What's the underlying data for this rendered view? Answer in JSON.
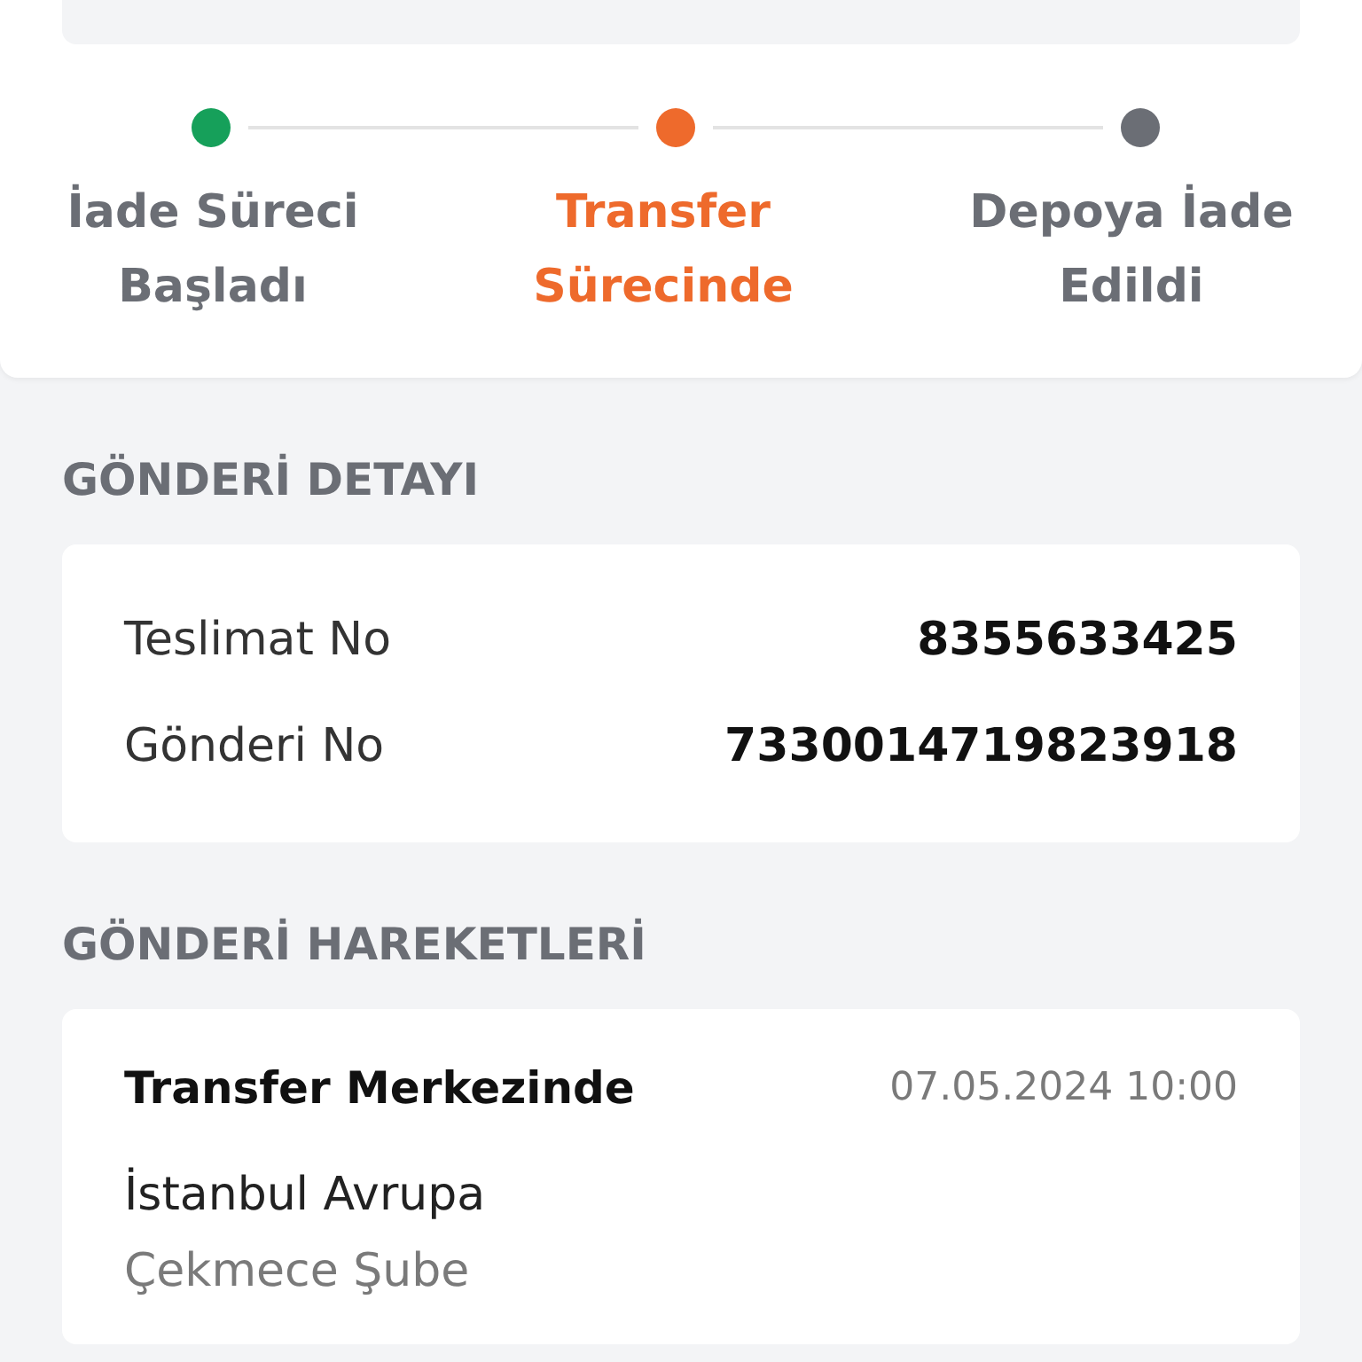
{
  "steps": [
    {
      "label": "İade Süreci Başladı",
      "color": "#16a05a",
      "selected": false
    },
    {
      "label": "Transfer Sürecinde",
      "color": "#ee6a2c",
      "selected": true
    },
    {
      "label": "Depoya İade Edildi",
      "color": "#6b6e75",
      "selected": false
    }
  ],
  "shipment_detail": {
    "title": "GÖNDERİ DETAYI",
    "rows": [
      {
        "label": "Teslimat No",
        "value": "8355633425"
      },
      {
        "label": "Gönderi No",
        "value": "7330014719823918"
      }
    ]
  },
  "shipment_movements": {
    "title": "GÖNDERİ HAREKETLERİ",
    "items": [
      {
        "status": "Transfer Merkezinde",
        "datetime": "07.05.2024 10:00",
        "city": "İstanbul Avrupa",
        "branch": "Çekmece Şube"
      }
    ]
  }
}
